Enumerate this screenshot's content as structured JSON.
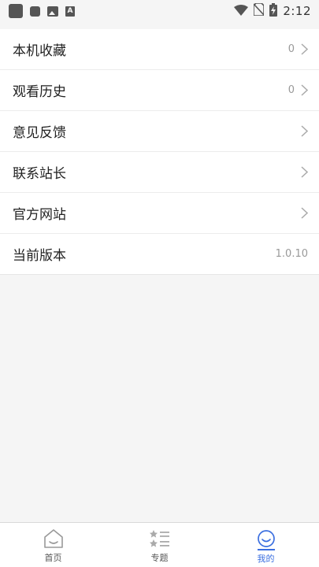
{
  "status_bar": {
    "time": "2:12",
    "icons": [
      "app-square-icon",
      "notification-icon",
      "image-icon",
      "font-icon",
      "wifi-icon",
      "no-sim-icon",
      "battery-charging-icon"
    ]
  },
  "menu": {
    "items": [
      {
        "label": "本机收藏",
        "value": "0",
        "has_chevron": true
      },
      {
        "label": "观看历史",
        "value": "0",
        "has_chevron": true
      },
      {
        "label": "意见反馈",
        "value": "",
        "has_chevron": true
      },
      {
        "label": "联系站长",
        "value": "",
        "has_chevron": true
      },
      {
        "label": "官方网站",
        "value": "",
        "has_chevron": true
      },
      {
        "label": "当前版本",
        "value": "1.0.10",
        "has_chevron": false
      }
    ]
  },
  "bottom_nav": {
    "items": [
      {
        "label": "首页",
        "icon": "home-icon",
        "active": false
      },
      {
        "label": "专题",
        "icon": "topics-list-icon",
        "active": false
      },
      {
        "label": "我的",
        "icon": "profile-smile-icon",
        "active": true
      }
    ]
  },
  "colors": {
    "accent": "#3b6fe0",
    "background": "#f5f5f5",
    "secondary_text": "#999999"
  }
}
